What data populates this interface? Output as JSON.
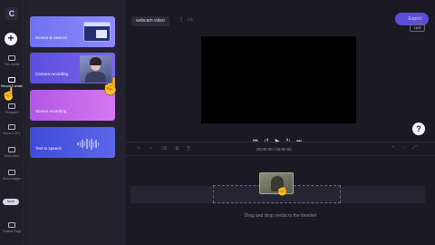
{
  "app": {
    "logo_label": "C"
  },
  "rail": {
    "add_label": "+",
    "items": [
      {
        "label": "Your media",
        "icon": "folder-icon"
      },
      {
        "label": "Record & create",
        "icon": "camera-icon"
      },
      {
        "label": "Templates",
        "icon": "templates-icon"
      },
      {
        "label": "Music & SFX",
        "icon": "music-icon"
      },
      {
        "label": "Stock video",
        "icon": "film-icon"
      },
      {
        "label": "Stock images",
        "icon": "image-icon"
      }
    ],
    "more_label": "More",
    "feature_flags_label": "Feature Flags"
  },
  "panel": {
    "cards": [
      {
        "title": "Screen & camera"
      },
      {
        "title": "Camera recording"
      },
      {
        "title": "Screen recording"
      },
      {
        "title": "Text to speech"
      }
    ]
  },
  "editor": {
    "project_name": "webcam video",
    "export_label": "Export",
    "aspect_ratio": "16:9",
    "timecode": "00:00.00 / 00:00.00",
    "help_label": "?",
    "drop_hint": "Drag and drop media to the timeline"
  },
  "colors": {
    "background": "#1b1a24",
    "accent": "#5a4fd6",
    "card_screen_camera": "#6d73f2",
    "card_camera_recording": "#5b4fdb",
    "card_screen_recording": "#b257e6",
    "card_text_to_speech": "#3f4bd6"
  }
}
